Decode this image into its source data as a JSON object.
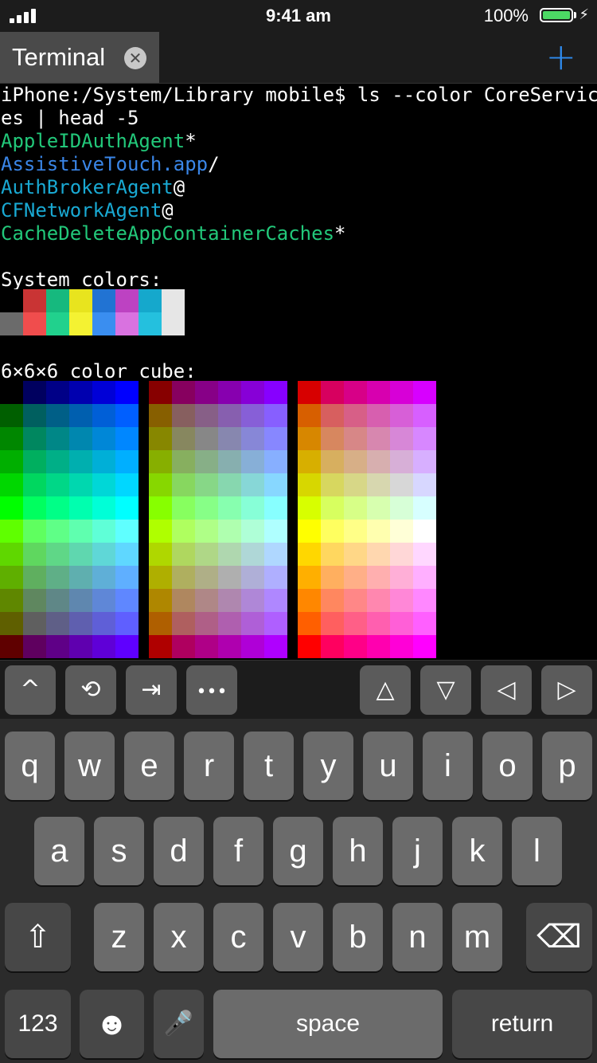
{
  "status_bar": {
    "time": "9:41 am",
    "battery_percent": "100%",
    "battery_level": 1.0,
    "battery_color": "#4cd964"
  },
  "tab_bar": {
    "tabs": [
      {
        "label": "Terminal",
        "close_icon": "close-circle-icon"
      }
    ],
    "new_tab_label": "+",
    "accent_color": "#2f8cf0"
  },
  "terminal": {
    "command_line_1": "iPhone:/System/Library mobile$ ls --color CoreServic",
    "command_line_2": "es | head -5",
    "listing": [
      {
        "name": "AppleIDAuthAgent",
        "suffix": "*",
        "color": "#22c87a"
      },
      {
        "name": "AssistiveTouch.app",
        "suffix": "/",
        "color": "#3a86e8"
      },
      {
        "name": "AuthBrokerAgent",
        "suffix": "@",
        "color": "#19a9d3"
      },
      {
        "name": "CFNetworkAgent",
        "suffix": "@",
        "color": "#19a9d3"
      },
      {
        "name": "CacheDeleteAppContainerCaches",
        "suffix": "*",
        "color": "#22c87a"
      }
    ],
    "system_colors_label": "System colors:",
    "system_colors_normal": [
      "#000000",
      "#c93434",
      "#16b97e",
      "#e8e41e",
      "#2173d3",
      "#bd42c2",
      "#15a8cc",
      "#e6e6e6"
    ],
    "system_colors_bright": [
      "#6b6b6b",
      "#f04d4d",
      "#21d18d",
      "#f4f232",
      "#3a8ef0",
      "#d972e0",
      "#24c0de",
      "#e6e6e6"
    ],
    "color_cube_label": "6×6×6 color cube:"
  },
  "accessory_bar": {
    "keys": [
      {
        "name": "ctrl-key",
        "glyph": "^",
        "icon": "caret-up-icon"
      },
      {
        "name": "history-key",
        "glyph": "⟲",
        "icon": "history-icon"
      },
      {
        "name": "tab-key",
        "glyph": "⇥",
        "icon": "tab-arrow-icon"
      },
      {
        "name": "more-key",
        "glyph": "•••",
        "icon": "ellipsis-icon"
      },
      {
        "name": "up-arrow-key",
        "glyph": "△",
        "icon": "arrow-up-icon"
      },
      {
        "name": "down-arrow-key",
        "glyph": "▽",
        "icon": "arrow-down-icon"
      },
      {
        "name": "left-arrow-key",
        "glyph": "◁",
        "icon": "arrow-left-icon"
      },
      {
        "name": "right-arrow-key",
        "glyph": "▷",
        "icon": "arrow-right-icon"
      }
    ]
  },
  "keyboard": {
    "row1": [
      "q",
      "w",
      "e",
      "r",
      "t",
      "y",
      "u",
      "i",
      "o",
      "p"
    ],
    "row2": [
      "a",
      "s",
      "d",
      "f",
      "g",
      "h",
      "j",
      "k",
      "l"
    ],
    "row3": [
      "z",
      "x",
      "c",
      "v",
      "b",
      "n",
      "m"
    ],
    "shift_glyph": "⇧",
    "delete_glyph": "⌫",
    "numbers_label": "123",
    "emoji_glyph": "☻",
    "mic_glyph": "🎤",
    "space_label": "space",
    "return_label": "return"
  }
}
